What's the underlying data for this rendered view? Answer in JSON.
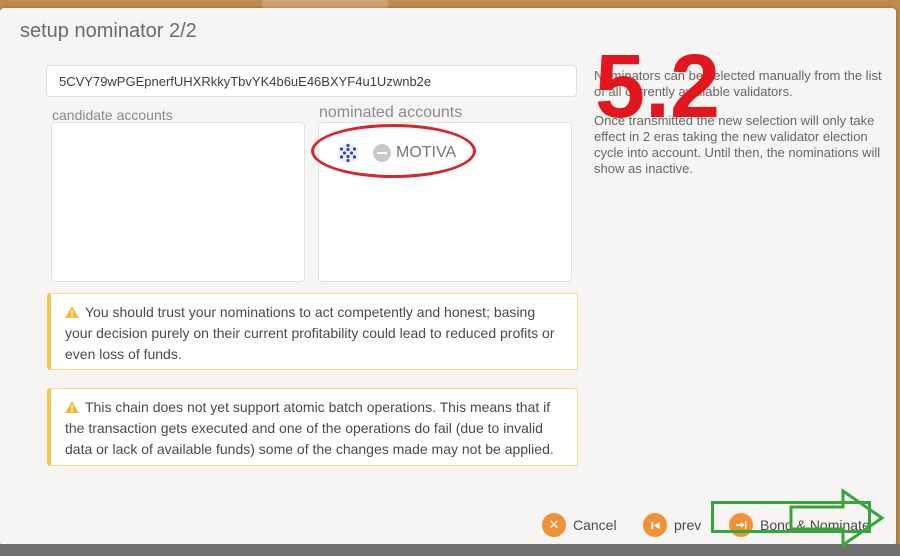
{
  "modal": {
    "title": "setup nominator 2/2",
    "stash_address": "5CVY79wPGEpnerfUHXRkkyTbvYK4b6uE46BXYF4u1Uzwnb2e",
    "candidate_label": "candidate accounts",
    "nominated_label": "nominated accounts",
    "nominated": [
      {
        "name": "MOTIVA",
        "icon": "identicon-icon"
      }
    ],
    "help_text_1": "Nominators can be selected manually from the list of all currently available validators.",
    "help_text_2": "Once transmitted the new selection will only take effect in 2 eras taking the new validator election cycle into account. Until then, the nominations will show as inactive.",
    "warnings": [
      "You should trust your nominations to act competently and honest; basing your decision purely on their current profitability could lead to reduced profits or even loss of funds.",
      "This chain does not yet support atomic batch operations. This means that if the transaction gets executed and one of the operations do fail (due to invalid data or lack of available funds) some of the changes made may not be applied."
    ],
    "buttons": {
      "cancel": "Cancel",
      "prev": "prev",
      "bond_nominate": "Bond & Nominate"
    }
  },
  "annotation": {
    "step_label": "5.2",
    "ellipse_color": "#d8262c",
    "arrow_color": "#36a63a"
  },
  "colors": {
    "accent": "#f19135",
    "warning_border": "#efc94e",
    "background": "#f6f5f3"
  }
}
